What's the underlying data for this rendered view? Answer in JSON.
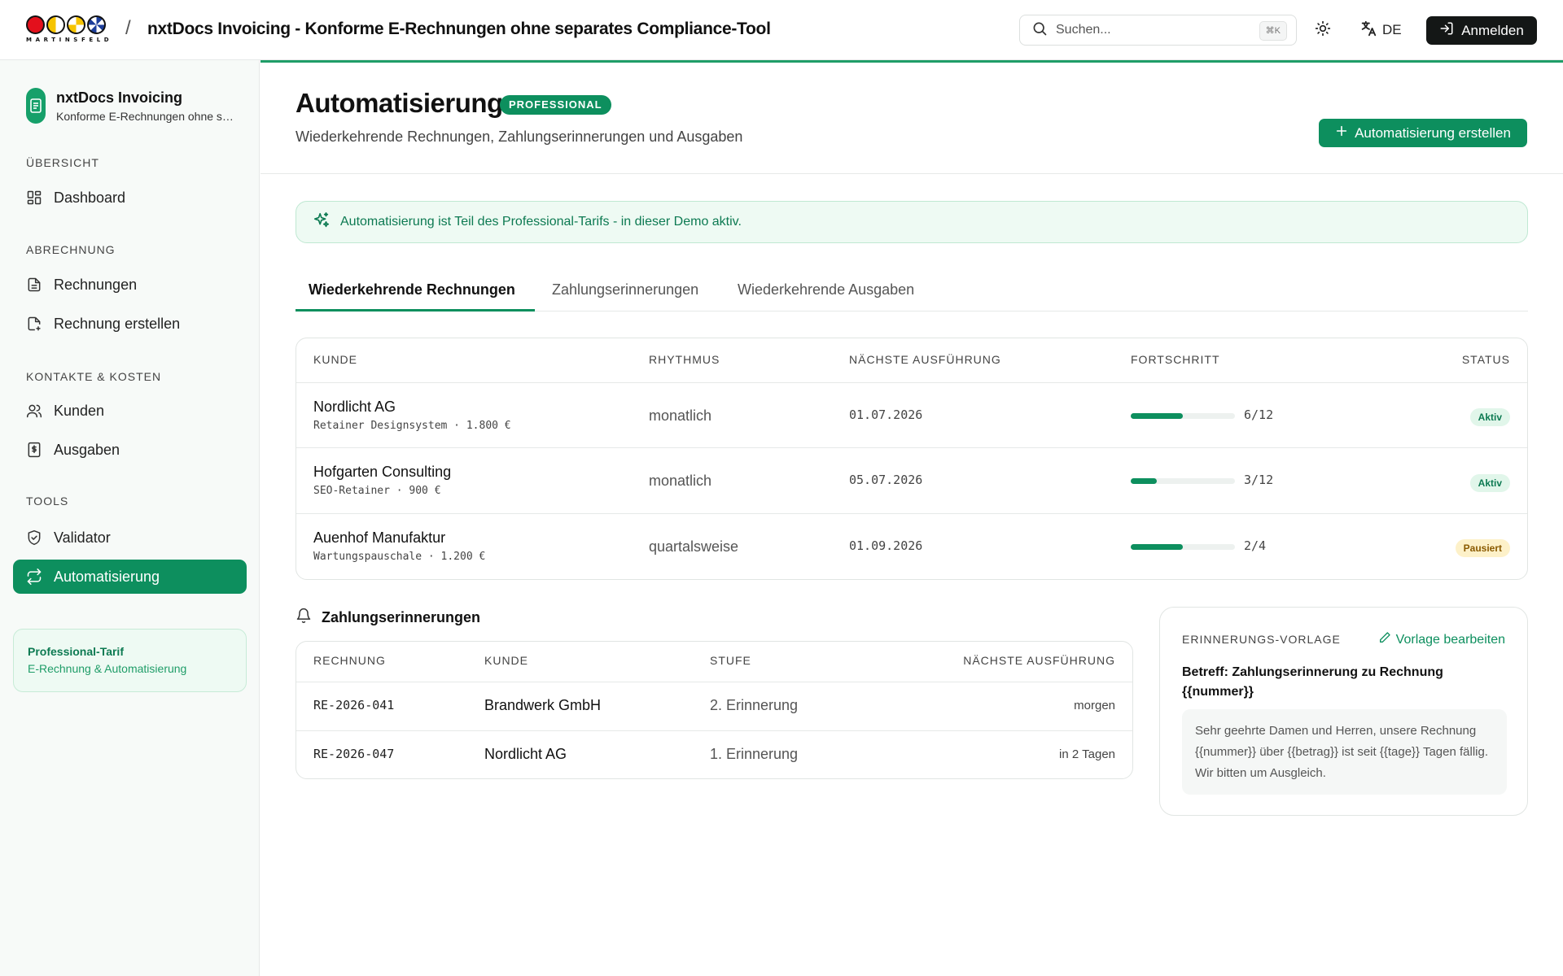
{
  "topbar": {
    "logo_text": "MARTINSFELD",
    "separator": "/",
    "title": "nxtDocs Invoicing - Konforme E-Rechnungen ohne separates Compliance-Tool",
    "search_placeholder": "Suchen...",
    "search_shortcut": "⌘K",
    "language": "DE",
    "login_label": "Anmelden"
  },
  "sidebar": {
    "brand_name": "nxtDocs Invoicing",
    "brand_sub": "Konforme E-Rechnungen ohne separates Compliance-Tool",
    "sections": [
      {
        "title": "ÜBERSICHT",
        "items": [
          {
            "label": "Dashboard",
            "icon": "dashboard-icon"
          }
        ]
      },
      {
        "title": "ABRECHNUNG",
        "items": [
          {
            "label": "Rechnungen",
            "icon": "document-icon"
          },
          {
            "label": "Rechnung erstellen",
            "icon": "document-plus-icon"
          }
        ]
      },
      {
        "title": "KONTAKTE & KOSTEN",
        "items": [
          {
            "label": "Kunden",
            "icon": "users-icon"
          },
          {
            "label": "Ausgaben",
            "icon": "receipt-icon"
          }
        ]
      },
      {
        "title": "TOOLS",
        "items": [
          {
            "label": "Validator",
            "icon": "shield-check-icon"
          },
          {
            "label": "Automatisierung",
            "icon": "repeat-icon",
            "active": true
          }
        ]
      }
    ],
    "plan": {
      "title": "Professional-Tarif",
      "subtitle": "E-Rechnung & Automatisierung"
    }
  },
  "header": {
    "title": "Automatisierung",
    "badge": "PROFESSIONAL",
    "subtitle": "Wiederkehrende Rechnungen, Zahlungserinnerungen und Ausgaben",
    "create_button": "Automatisierung erstellen"
  },
  "banner": {
    "text": "Automatisierung ist Teil des Professional-Tarifs - in dieser Demo aktiv."
  },
  "tabs": [
    {
      "label": "Wiederkehrende Rechnungen",
      "active": true
    },
    {
      "label": "Zahlungserinnerungen"
    },
    {
      "label": "Wiederkehrende Ausgaben"
    }
  ],
  "recurring": {
    "columns": [
      "KUNDE",
      "RHYTHMUS",
      "NÄCHSTE AUSFÜHRUNG",
      "FORTSCHRITT",
      "STATUS"
    ],
    "rows": [
      {
        "customer": "Nordlicht AG",
        "detail": "Retainer Designsystem · 1.800 €",
        "rhythm": "monatlich",
        "next": "01.07.2026",
        "done": 6,
        "total": 12,
        "progress_label": "6/12",
        "status": "Aktiv",
        "status_kind": "active"
      },
      {
        "customer": "Hofgarten Consulting",
        "detail": "SEO-Retainer · 900 €",
        "rhythm": "monatlich",
        "next": "05.07.2026",
        "done": 3,
        "total": 12,
        "progress_label": "3/12",
        "status": "Aktiv",
        "status_kind": "active"
      },
      {
        "customer": "Auenhof Manufaktur",
        "detail": "Wartungspauschale · 1.200 €",
        "rhythm": "quartalsweise",
        "next": "01.09.2026",
        "done": 2,
        "total": 4,
        "progress_label": "2/4",
        "status": "Pausiert",
        "status_kind": "paused"
      }
    ]
  },
  "reminders": {
    "title": "Zahlungserinnerungen",
    "columns": [
      "RECHNUNG",
      "KUNDE",
      "STUFE",
      "NÄCHSTE AUSFÜHRUNG"
    ],
    "rows": [
      {
        "invoice": "RE-2026-041",
        "customer": "Brandwerk GmbH",
        "stage": "2. Erinnerung",
        "next": "morgen"
      },
      {
        "invoice": "RE-2026-047",
        "customer": "Nordlicht AG",
        "stage": "1. Erinnerung",
        "next": "in 2 Tagen"
      }
    ]
  },
  "template": {
    "label": "ERINNERUNGS-VORLAGE",
    "edit_label": "Vorlage bearbeiten",
    "subject": "Betreff: Zahlungserinnerung zu Rechnung {{nummer}}",
    "body": "Sehr geehrte Damen und Herren, unsere Rechnung {{nummer}} über {{betrag}} ist seit {{tage}} Tagen fällig. Wir bitten um Ausgleich."
  },
  "colors": {
    "accent": "#0d8f5e",
    "accent_light": "#eefaf3",
    "paused": "#fdf1c9"
  }
}
